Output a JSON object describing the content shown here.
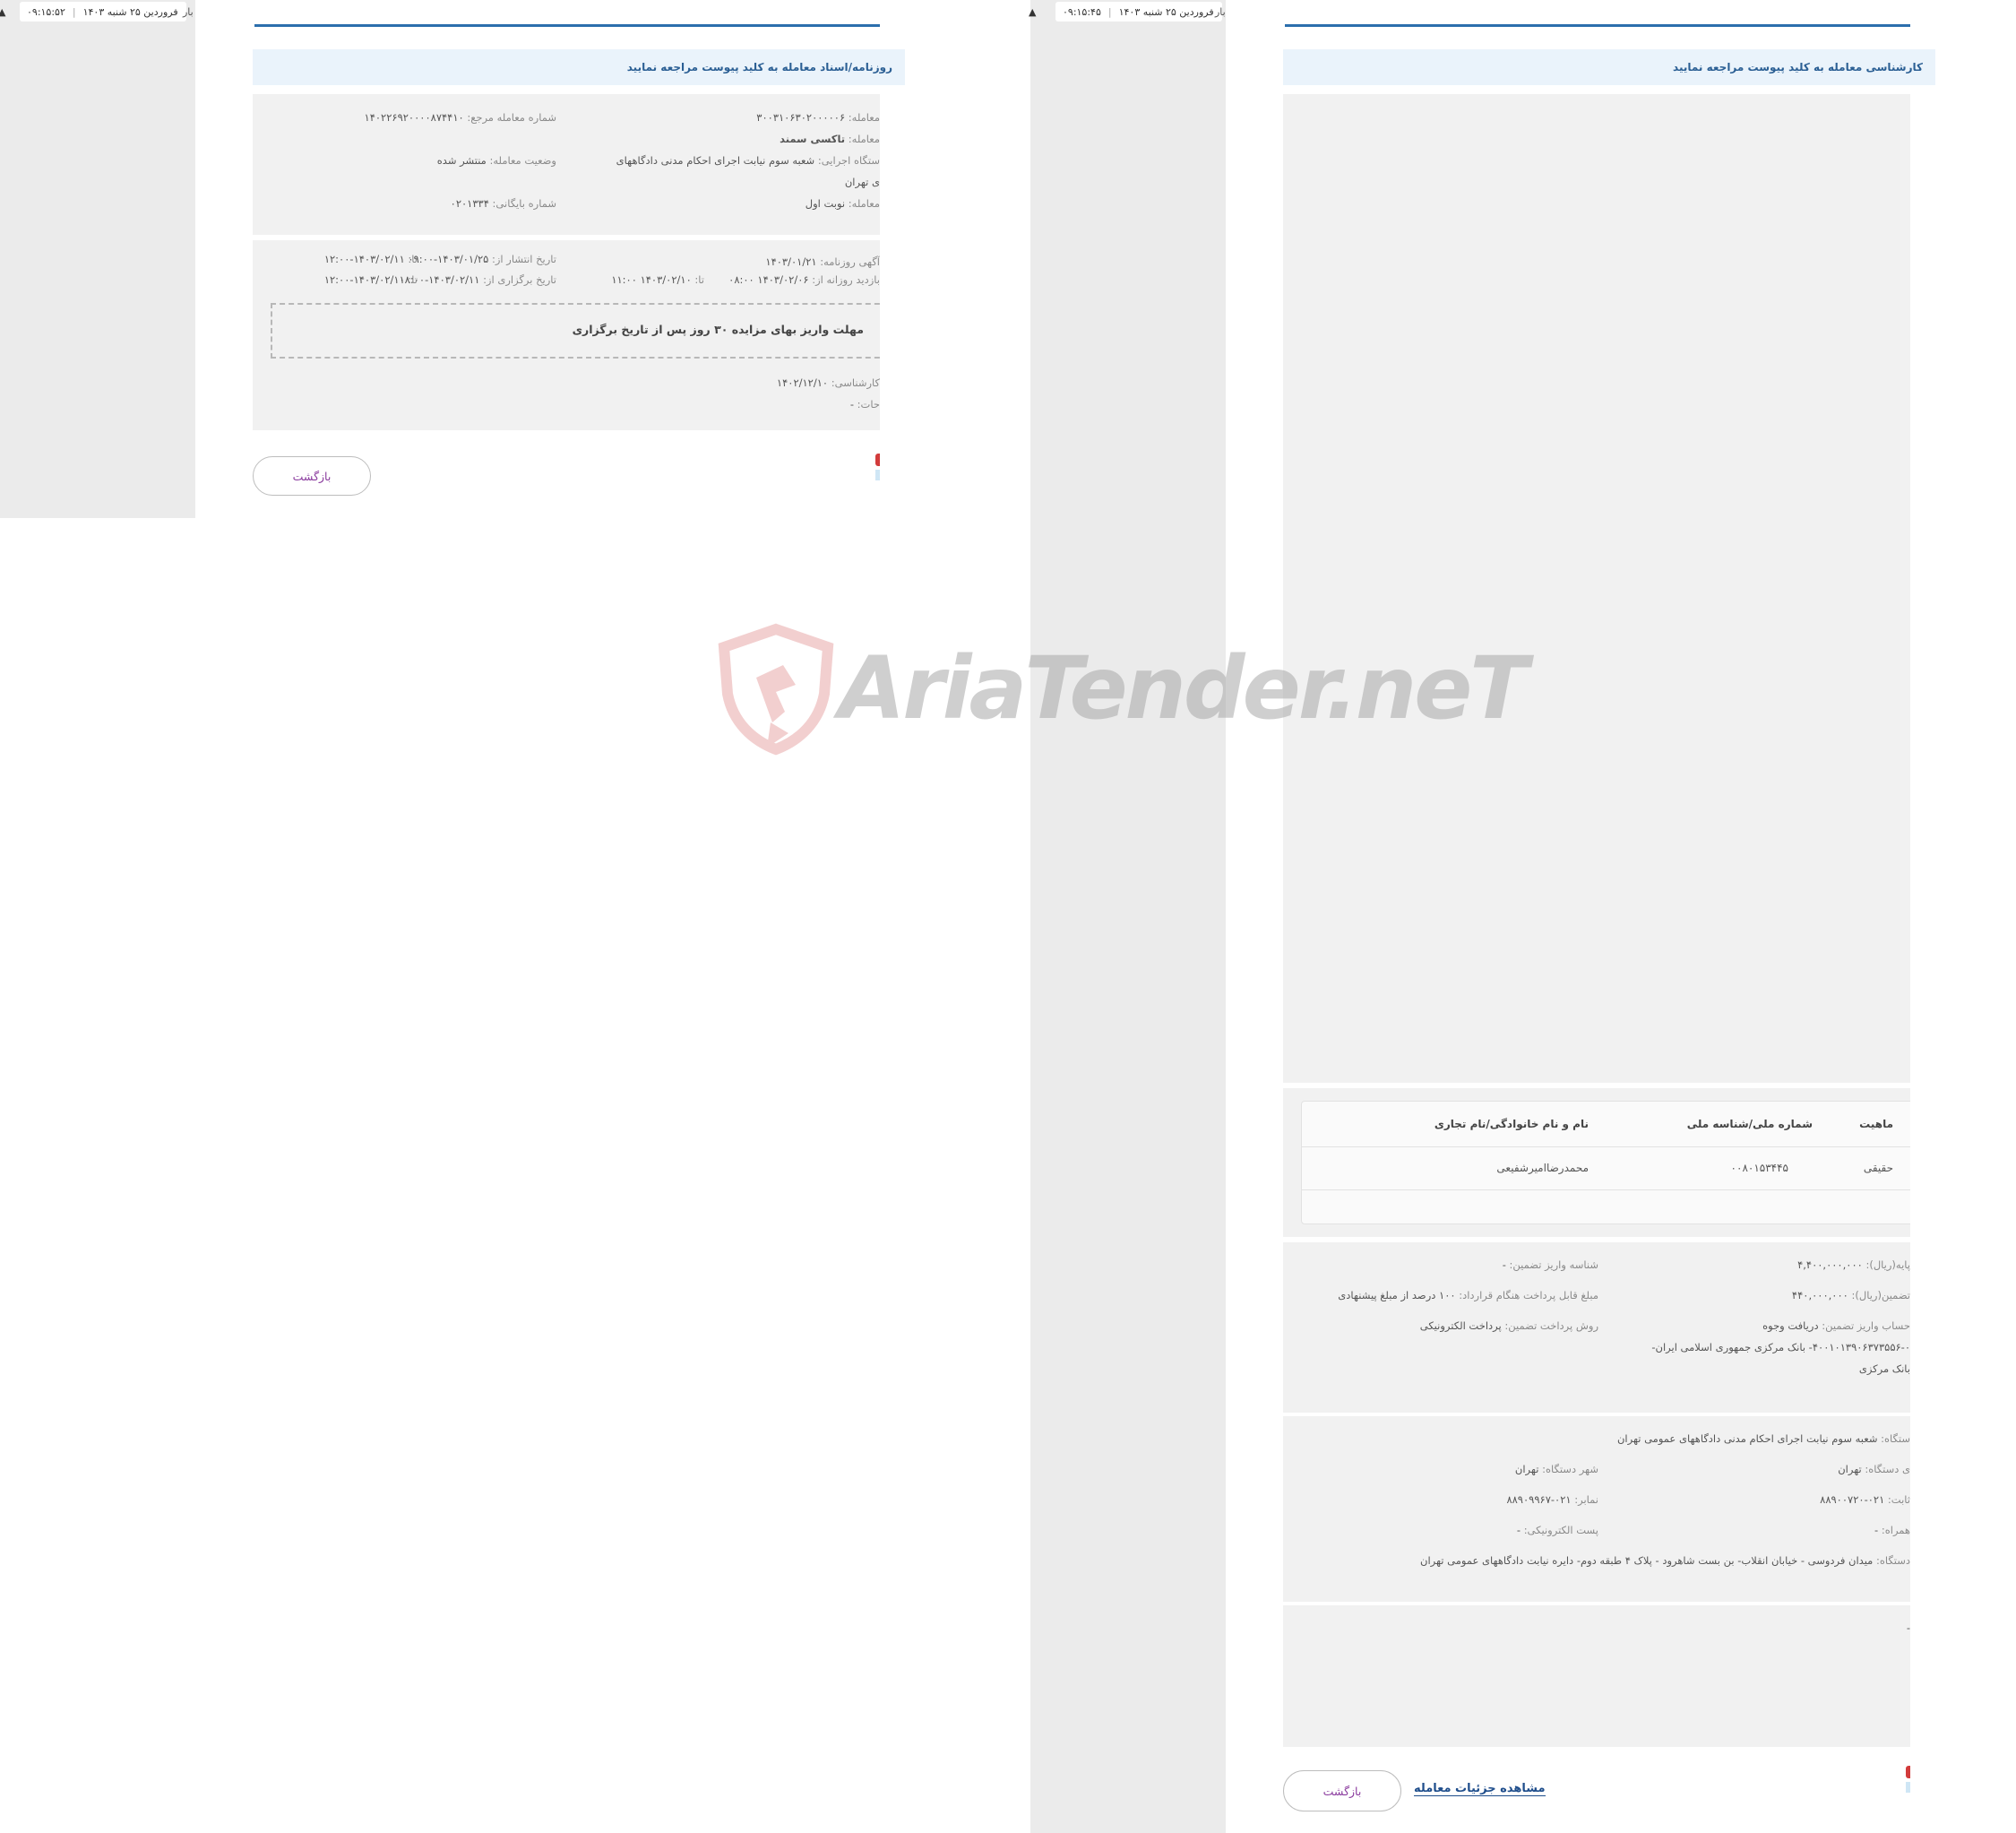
{
  "left_window": {
    "top_bar": {
      "time": "۰۹:۱۵:۵۲",
      "date": "فروردین ۲۵ شنبه ۱۴۰۳",
      "cut_label": "بار"
    },
    "info_banner": "روزنامه/اسناد معامله به کلید پیوست مراجعه نمایید",
    "details": {
      "deal_number": {
        "label": "معامله:",
        "value": "۳۰۰۳۱۰۶۳۰۲۰۰۰۰۰۶"
      },
      "ref_number": {
        "label": "شماره معامله مرجع:",
        "value": "۱۴۰۲۲۶۹۲۰۰۰۰۸۷۴۴۱۰"
      },
      "deal_subject": {
        "label": "معامله:",
        "value": "تاکسی سمند"
      },
      "executor": {
        "label": "ستگاه اجرایی:",
        "value": "شعبه سوم نیابت اجرای احکام مدنی دادگاههای"
      },
      "executor_cont": "ی تهران",
      "status": {
        "label": "وضعیت معامله:",
        "value": "منتشر شده"
      },
      "deal_type": {
        "label": "معامله:",
        "value": "نوبت اول"
      },
      "archive": {
        "label": "شماره بایگانی:",
        "value": "۰۲۰۱۳۳۴"
      }
    },
    "dates": {
      "newspaper": {
        "label": "آگهی روزنامه:",
        "value": "۱۴۰۳/۰۱/۲۱"
      },
      "publish_from": {
        "label": "تاریخ انتشار از:",
        "value": "۱۴۰۳/۰۱/۲۵-۰۹:۰۰"
      },
      "publish_to": {
        "label": "تا:",
        "value": "۱۴۰۳/۰۲/۱۱-۱۲:۰۰"
      },
      "visit_from": {
        "label": "بازدید روزانه از:",
        "value": "۱۴۰۳/۰۲/۰۶   ۰۸:۰۰"
      },
      "visit_to": {
        "label": "تا:",
        "value": "۱۴۰۳/۰۲/۱۰   ۱۱:۰۰"
      },
      "hold_from": {
        "label": "تاریخ برگزاری از:",
        "value": "۱۴۰۳/۰۲/۱۱-۰۸:۰۰"
      },
      "hold_to": {
        "label": "تا:",
        "value": "۱۴۰۳/۰۲/۱۱-۱۲:۰۰"
      }
    },
    "notice": "مهلت واریز بهای مزایده ۳۰ روز پس از تاریخ برگزاری",
    "expert": {
      "label": "کارشناسی:",
      "value": "۱۴۰۲/۱۲/۱۰"
    },
    "description": {
      "label": "حات:",
      "value": "-"
    },
    "back_button": "بازگشت"
  },
  "right_window": {
    "top_bar": {
      "time": "۰۹:۱۵:۴۵",
      "date": "فروردین ۲۵ شنبه ۱۴۰۳",
      "cut_label": "بار"
    },
    "info_banner": "کارشناسی معامله به کلید پیوست مراجعه نمایید",
    "table": {
      "headers": [
        "ماهیت",
        "شماره ملی/شناسه ملی",
        "نام و نام خانوادگی/نام تجاری"
      ],
      "rows": [
        [
          "حقیقی",
          "۰۰۸۰۱۵۳۴۴۵",
          "محمدرضاامیرشفیعی"
        ]
      ]
    },
    "finance": {
      "base_price": {
        "label": "پایه(ریال):",
        "value": "۴,۴۰۰,۰۰۰,۰۰۰"
      },
      "guarantee_id": {
        "label": "شناسه واریز تضمین:",
        "value": "-"
      },
      "guarantee_amount": {
        "label": "تضمین(ریال):",
        "value": "۴۴۰,۰۰۰,۰۰۰"
      },
      "contract_payment": {
        "label": "مبلغ قابل پرداخت هنگام قرارداد:",
        "value": "۱۰۰ درصد از مبلغ پیشنهادی"
      },
      "account": {
        "label": "حساب واریز تضمین:",
        "value": "دریافت وجوه"
      },
      "payment_method": {
        "label": "روش پرداخت تضمین:",
        "value": "پرداخت الکترونیکی"
      },
      "account_line2": "۴۰۰۱۰۱۳۹۰۶۳۷۳۵۵۶-۰- بانک مرکزی جمهوری اسلامی ایران-",
      "account_line3": "بانک مرکزی"
    },
    "org": {
      "name": {
        "label": "ستگاه:",
        "value": "شعبه سوم نیابت اجرای احکام مدنی دادگاههای عمومی تهران"
      },
      "province": {
        "label": "ی دستگاه:",
        "value": "تهران"
      },
      "city": {
        "label": "شهر دستگاه:",
        "value": "تهران"
      },
      "phone": {
        "label": "ثابت:",
        "value": "۰۲۱-۸۸۹۰۰۷۲۰"
      },
      "fax": {
        "label": "نمابر:",
        "value": "۰۲۱-۸۸۹۰۹۹۶۷"
      },
      "mobile": {
        "label": "همراه:",
        "value": "-"
      },
      "email": {
        "label": "پست الکترونیکی:",
        "value": "-"
      },
      "address": {
        "label": "دستگاه:",
        "value": "میدان فردوسی - خیابان انقلاب- بن بست شاهرود - پلاک ۴ طبقه دوم- دایره نیابت دادگاههای عمومی تهران"
      }
    },
    "extra": "-",
    "back_button": "بازگشت",
    "details_link": "مشاهده جزئیات معامله"
  },
  "watermark": "AriaTender.neT"
}
